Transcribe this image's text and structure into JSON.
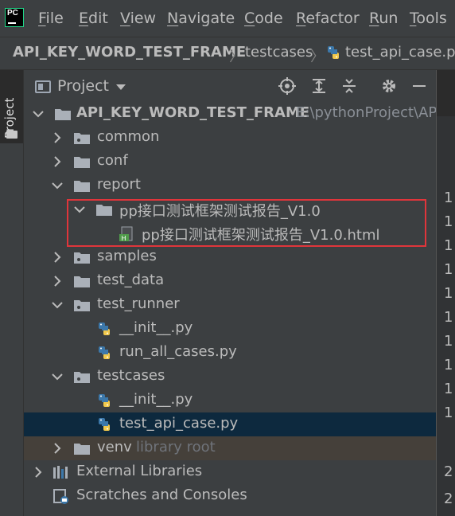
{
  "menu": {
    "logo": "PC",
    "items": [
      {
        "mnemonic": "F",
        "rest": "ile"
      },
      {
        "mnemonic": "E",
        "rest": "dit"
      },
      {
        "mnemonic": "V",
        "rest": "iew"
      },
      {
        "mnemonic": "N",
        "rest": "avigate"
      },
      {
        "mnemonic": "C",
        "rest": "ode"
      },
      {
        "mnemonic": "R",
        "rest": "efactor"
      },
      {
        "mnemonic": "R",
        "rest": "un"
      },
      {
        "mnemonic": "T",
        "rest": "ools"
      }
    ]
  },
  "breadcrumb": {
    "root": "API_KEY_WORD_TEST_FRAME",
    "folder": "testcases",
    "file": "test_api_case.py"
  },
  "toolstrip": {
    "project_tab": "Project"
  },
  "panel": {
    "title": "Project",
    "buttons": [
      "locate-icon",
      "expand-all-icon",
      "collapse-all-icon",
      "gear-icon",
      "hide-icon"
    ]
  },
  "tree": {
    "root": {
      "name": "API_KEY_WORD_TEST_FRAME",
      "path": "E:\\pythonProject\\AP"
    },
    "common": "common",
    "conf": "conf",
    "report": "report",
    "report_folder": "pp接口测试框架测试报告_V1.0",
    "report_file": "pp接口测试框架测试报告_V1.0.html",
    "samples": "samples",
    "test_data": "test_data",
    "test_runner": "test_runner",
    "runner_init": "__init__.py",
    "runner_all": "run_all_cases.py",
    "testcases": "testcases",
    "testcases_init": "__init__.py",
    "testcases_api": "test_api_case.py",
    "venv": "venv",
    "venv_note": "library root",
    "external": "External Libraries",
    "scratches": "Scratches and Consoles"
  },
  "gutter": {
    "line_numbers": [
      "1",
      "1",
      "1",
      "1",
      "1",
      "1",
      "1",
      "1",
      "1",
      "1",
      "2",
      "2"
    ]
  },
  "colors": {
    "highlight": "#e0353b",
    "selected": "#0d293e",
    "folder": "#aab0b8"
  }
}
